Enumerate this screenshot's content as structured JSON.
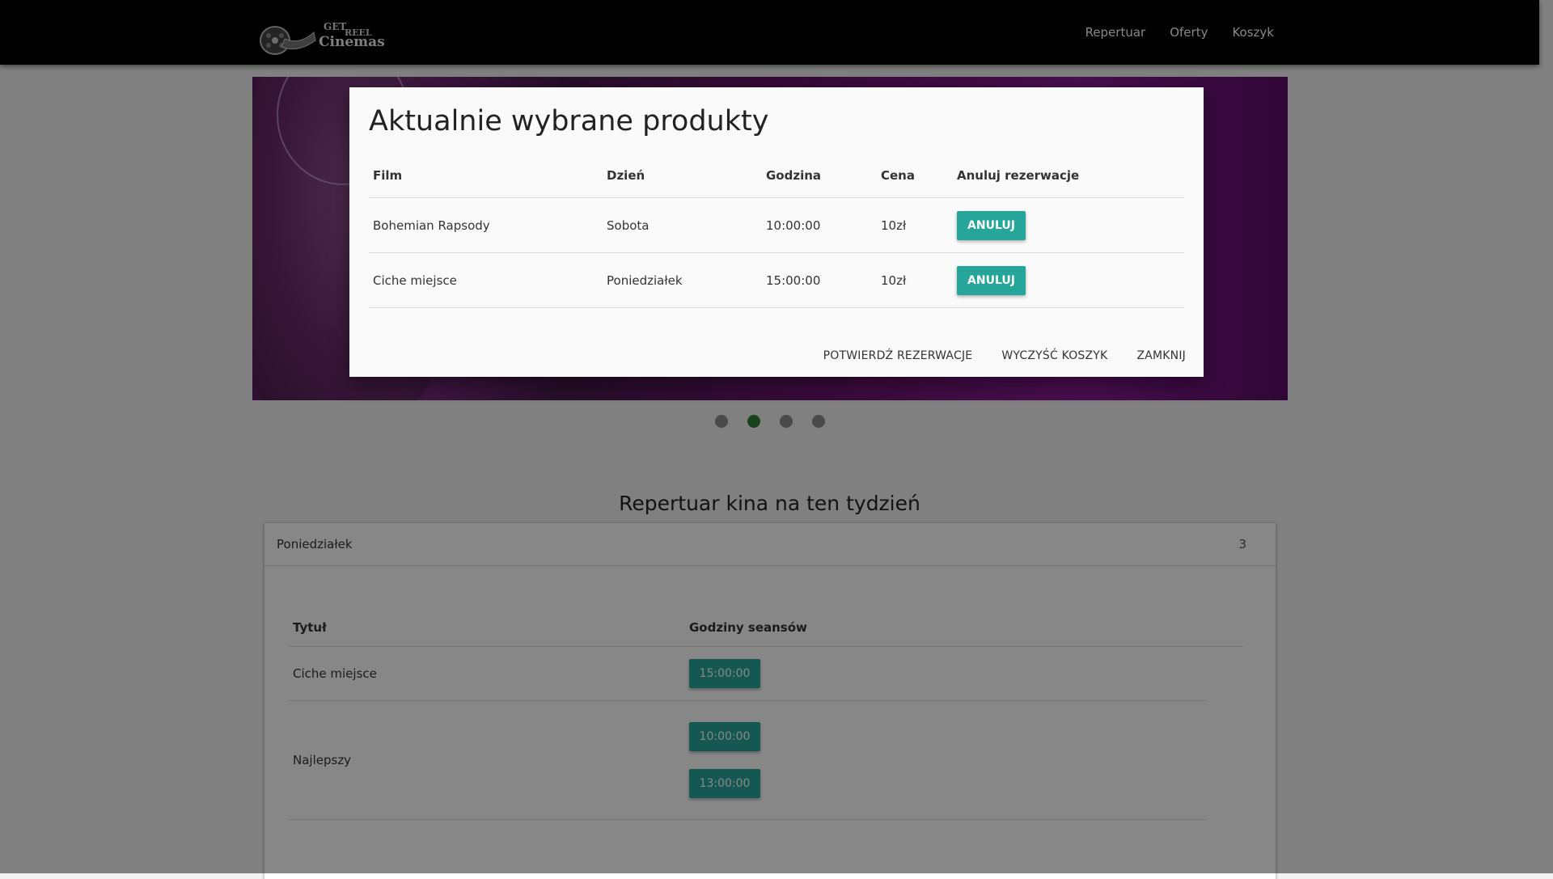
{
  "brand": {
    "get": "GET",
    "reel": "REEL",
    "cinemas": "Cinemas"
  },
  "nav": {
    "repertuar": "Repertuar",
    "oferty": "Oferty",
    "koszyk": "Koszyk"
  },
  "carousel": {
    "slides": 4,
    "active_index": 1
  },
  "schedule": {
    "title": "Repertuar kina na ten tydzień",
    "day": "Poniedziałek",
    "count": "3",
    "headers": {
      "title": "Tytuł",
      "times": "Godziny seansów"
    },
    "rows": [
      {
        "title": "Ciche miejsce",
        "times": [
          "15:00:00"
        ]
      },
      {
        "title": "Najlepszy",
        "times": [
          "10:00:00",
          "13:00:00"
        ]
      }
    ]
  },
  "modal": {
    "title": "Aktualnie wybrane produkty",
    "headers": {
      "film": "Film",
      "day": "Dzień",
      "time": "Godzina",
      "price": "Cena",
      "cancel": "Anuluj rezerwacje"
    },
    "rows": [
      {
        "film": "Bohemian Rapsody",
        "day": "Sobota",
        "time": "10:00:00",
        "price": "10zł",
        "action": "ANULUJ"
      },
      {
        "film": "Ciche miejsce",
        "day": "Poniedziałek",
        "time": "15:00:00",
        "price": "10zł",
        "action": "ANULUJ"
      }
    ],
    "footer": {
      "confirm": "POTWIERDŹ REZERWACJE",
      "clear": "WYCZYŚĆ KOSZYK",
      "close": "ZAMKNIJ"
    }
  },
  "colors": {
    "accent": "#26a69a",
    "active_dot": "#2e7d32",
    "navbar": "#000000"
  }
}
